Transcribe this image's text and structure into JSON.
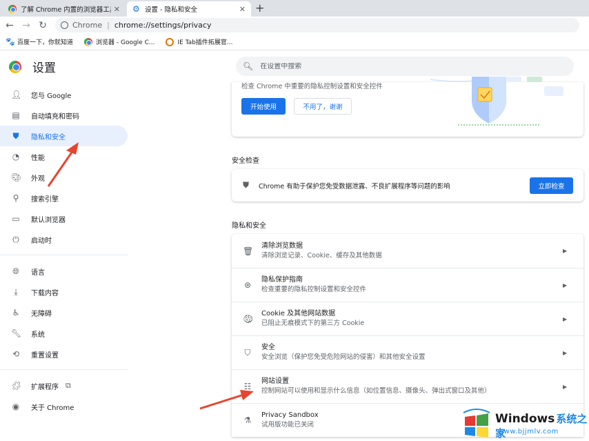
{
  "tabs": [
    {
      "title": "了解 Chrome 内置的浏览器工具",
      "icon": "chrome-icon",
      "active": false
    },
    {
      "title": "设置 - 隐私和安全",
      "icon": "gear-icon",
      "active": true
    }
  ],
  "new_tab": "+",
  "toolbar": {
    "omnibox_host": "Chrome",
    "omnibox_sep": "|",
    "omnibox_url": "chrome://settings/privacy"
  },
  "bookmarks": [
    {
      "label": "百度一下，你就知道",
      "icon": "paw-icon"
    },
    {
      "label": "浏览器 - Google C...",
      "icon": "chrome-icon"
    },
    {
      "label": "IE Tab插件拓展官...",
      "icon": "ie-icon"
    }
  ],
  "header": {
    "title": "设置",
    "search_placeholder": "在设置中搜索"
  },
  "sidebar": {
    "items": [
      {
        "label": "您与 Google",
        "icon": "person-icon",
        "active": false
      },
      {
        "label": "自动填充和密码",
        "icon": "clipboard-icon",
        "active": false
      },
      {
        "label": "隐私和安全",
        "icon": "shield-icon",
        "active": true
      },
      {
        "label": "性能",
        "icon": "speedometer-icon",
        "active": false
      },
      {
        "label": "外观",
        "icon": "palette-icon",
        "active": false
      },
      {
        "label": "搜索引擎",
        "icon": "search-icon",
        "active": false
      },
      {
        "label": "默认浏览器",
        "icon": "browser-icon",
        "active": false
      },
      {
        "label": "启动时",
        "icon": "power-icon",
        "active": false
      }
    ],
    "items2": [
      {
        "label": "语言",
        "icon": "globe-icon"
      },
      {
        "label": "下载内容",
        "icon": "download-icon"
      },
      {
        "label": "无障碍",
        "icon": "accessibility-icon"
      },
      {
        "label": "系统",
        "icon": "wrench-icon"
      },
      {
        "label": "重置设置",
        "icon": "reset-icon"
      }
    ],
    "items3": [
      {
        "label": "扩展程序",
        "icon": "puzzle-icon"
      },
      {
        "label": "关于 Chrome",
        "icon": "chrome-icon"
      }
    ]
  },
  "guide_card": {
    "description": "检查 Chrome 中重要的隐私控制设置和安全控件",
    "start_label": "开始使用",
    "dismiss_label": "不用了，谢谢"
  },
  "safety_check": {
    "section_title": "安全检查",
    "text": "Chrome 有助于保护您免受数据泄露、不良扩展程序等问题的影响",
    "button_label": "立即检查"
  },
  "privacy": {
    "section_title": "隐私和安全",
    "rows": [
      {
        "title": "清除浏览数据",
        "sub": "清除浏览记录、Cookie、缓存及其他数据",
        "icon": "trash-icon"
      },
      {
        "title": "隐私保护指南",
        "sub": "检查重要的隐私控制设置和安全控件",
        "icon": "compass-icon"
      },
      {
        "title": "Cookie 及其他网站数据",
        "sub": "已阻止无痕模式下的第三方 Cookie",
        "icon": "cookie-icon"
      },
      {
        "title": "安全",
        "sub": "安全浏览（保护您免受危险网站的侵害）和其他安全设置",
        "icon": "shield-icon"
      },
      {
        "title": "网站设置",
        "sub": "控制网站可以使用和显示什么信息（如位置信息、摄像头、弹出式窗口及其他）",
        "icon": "sliders-icon"
      },
      {
        "title": "Privacy Sandbox",
        "sub": "试用版功能已关闭",
        "icon": "flask-icon"
      }
    ]
  },
  "watermark": {
    "brand": "Windows",
    "brand_cn": "系统之家",
    "url": "www.bjjmlv.com"
  },
  "colors": {
    "accent": "#1a73e8",
    "annotation_arrow": "#e8432e"
  }
}
